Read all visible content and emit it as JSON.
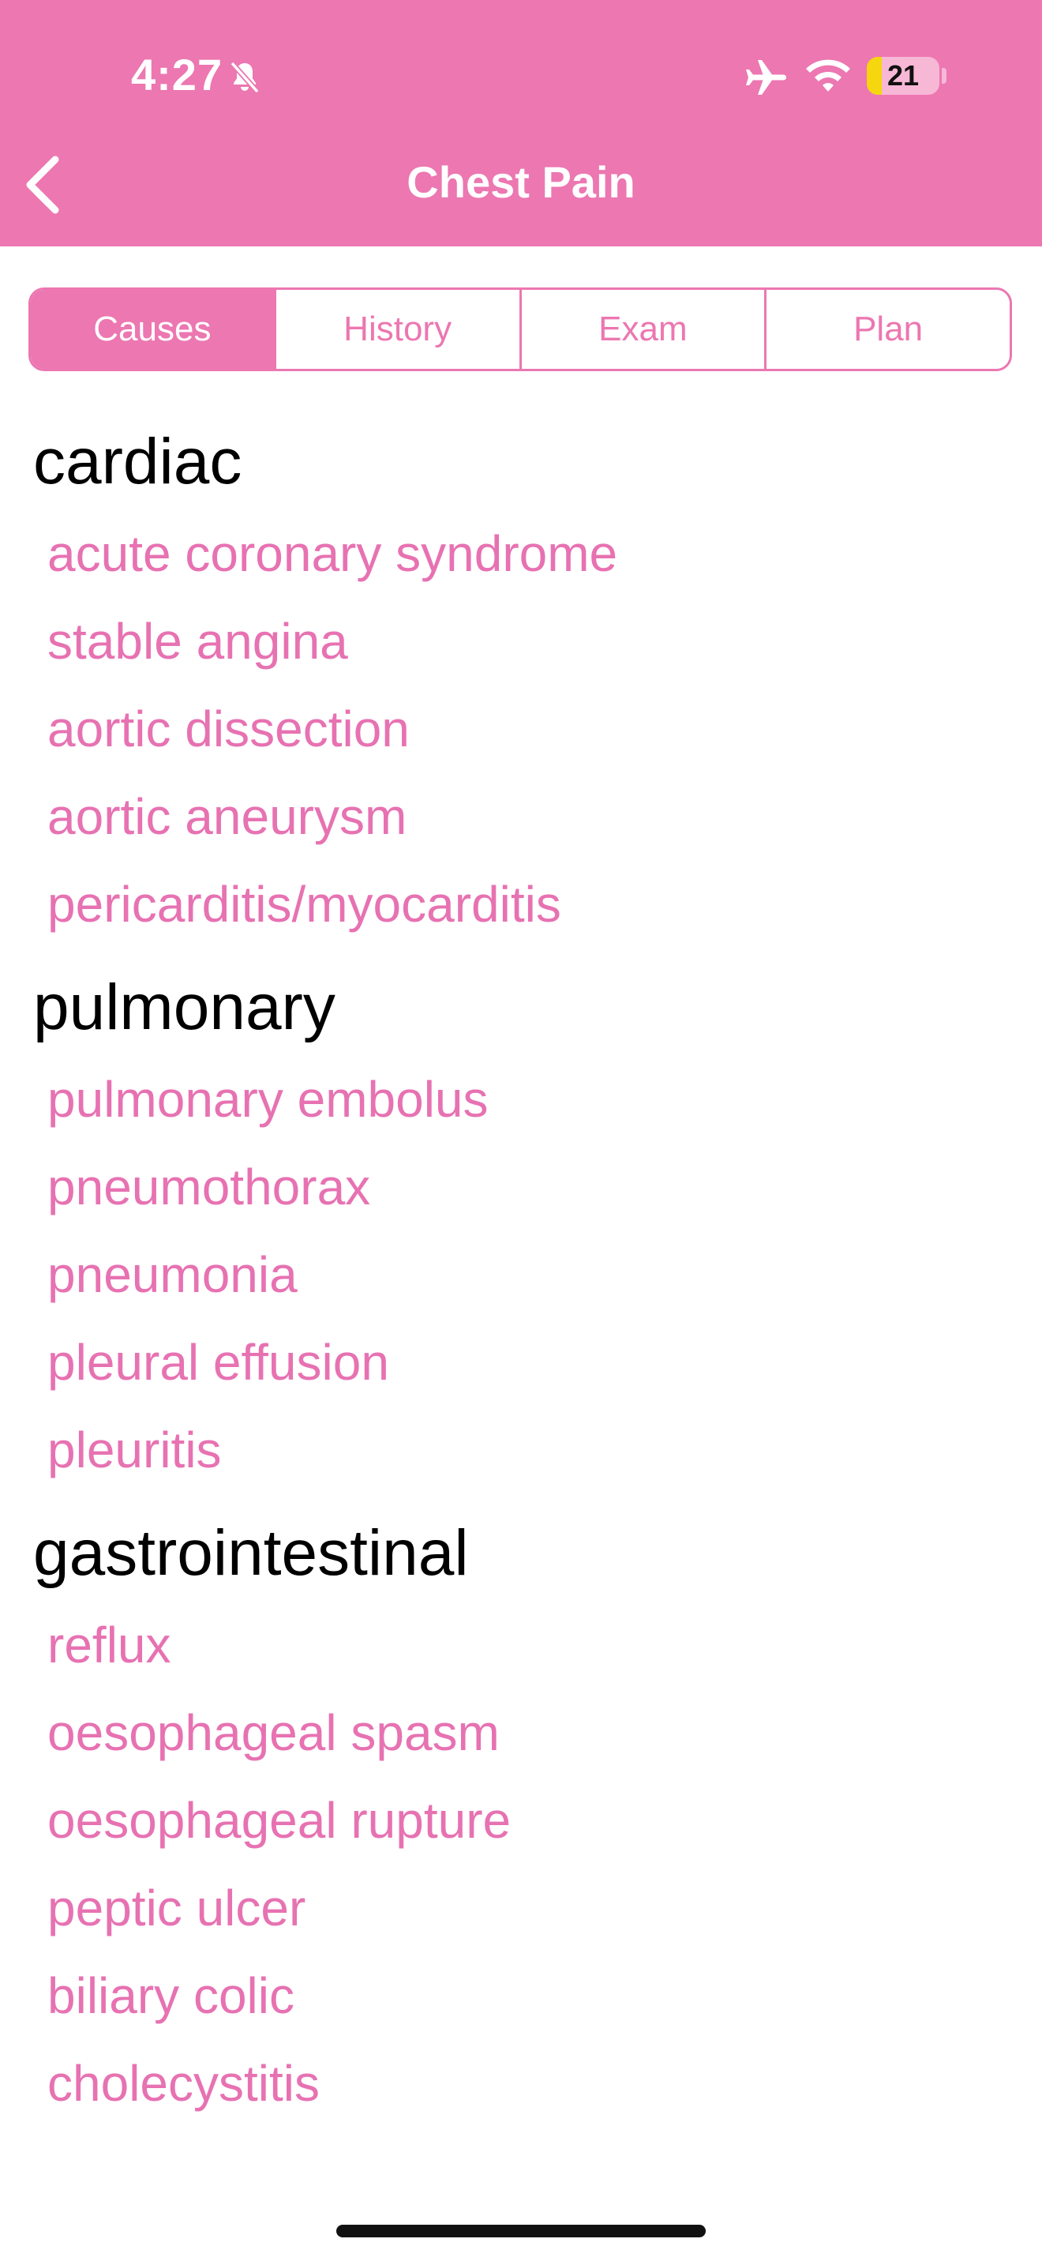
{
  "status_bar": {
    "time": "4:27",
    "battery_level": "21",
    "battery_fraction": 0.21,
    "icons": [
      "bell-slash-icon",
      "airplane-icon",
      "wifi-icon",
      "battery-icon"
    ]
  },
  "nav": {
    "title": "Chest Pain",
    "back_icon": "chevron-left-icon"
  },
  "tabs": [
    {
      "label": "Causes",
      "active": true
    },
    {
      "label": "History",
      "active": false
    },
    {
      "label": "Exam",
      "active": false
    },
    {
      "label": "Plan",
      "active": false
    }
  ],
  "sections": [
    {
      "heading": "cardiac",
      "items": [
        "acute coronary syndrome",
        "stable angina",
        "aortic dissection",
        "aortic aneurysm",
        "pericarditis/myocarditis"
      ]
    },
    {
      "heading": "pulmonary",
      "items": [
        "pulmonary embolus",
        "pneumothorax",
        "pneumonia",
        "pleural effusion",
        "pleuritis"
      ]
    },
    {
      "heading": "gastrointestinal",
      "items": [
        "reflux",
        "oesophageal spasm",
        "oesophageal rupture",
        "peptic ulcer",
        "biliary colic",
        "cholecystitis"
      ]
    }
  ],
  "colors": {
    "accent": "#ec77b1",
    "link": "#e772b2",
    "heading": "#000000"
  }
}
